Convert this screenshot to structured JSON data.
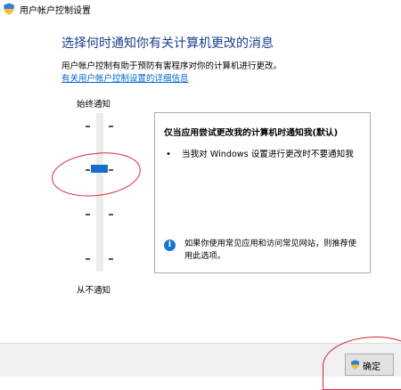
{
  "window": {
    "title": "用户帐户控制设置"
  },
  "main": {
    "heading": "选择何时通知你有关计算机更改的消息",
    "description": "用户帐户控制有助于预防有害程序对你的计算机进行更改。",
    "link": "有关用户帐户控制设置的详细信息"
  },
  "slider": {
    "top_label": "始终通知",
    "bottom_label": "从不通知",
    "levels": 4,
    "selected_level": 3,
    "selected_level_note": "level 3 of 4 counted from bottom"
  },
  "panel": {
    "title": "仅当应用尝试更改我的计算机时通知我(默认)",
    "bullets": [
      "当我对 Windows 设置进行更改时不要通知我"
    ],
    "info": "如果你使用常见应用和访问常见网站，则推荐使用此选项。"
  },
  "footer": {
    "ok_label": "确定"
  },
  "colors": {
    "accent": "#1471c8",
    "heading": "#1a3e8c",
    "annotation": "#d8253c"
  },
  "icons": [
    "shield-icon",
    "info-icon"
  ]
}
